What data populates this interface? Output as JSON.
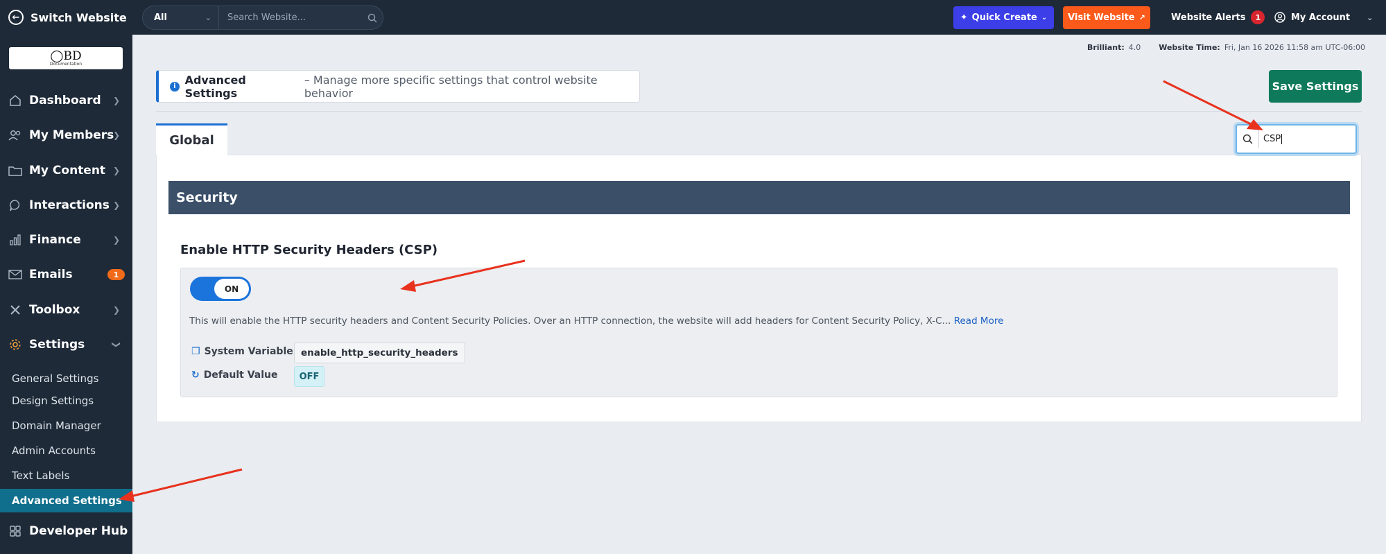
{
  "topbar": {
    "switch_label": "Switch Website",
    "search_scope": "All",
    "search_placeholder": "Search Website...",
    "quick_create": "Quick Create",
    "visit_website": "Visit Website",
    "alerts_label": "Website Alerts",
    "alerts_count": "1",
    "account_label": "My Account"
  },
  "sidebar": {
    "logo_text": "BD",
    "logo_subtext": "Documentation",
    "items": [
      {
        "label": "Dashboard",
        "icon": "home-icon"
      },
      {
        "label": "My Members",
        "icon": "members-icon"
      },
      {
        "label": "My Content",
        "icon": "folder-icon"
      },
      {
        "label": "Interactions",
        "icon": "chat-icon"
      },
      {
        "label": "Finance",
        "icon": "chart-icon"
      },
      {
        "label": "Emails",
        "icon": "mail-icon",
        "badge": "1"
      },
      {
        "label": "Toolbox",
        "icon": "tools-icon"
      },
      {
        "label": "Settings",
        "icon": "gear-icon"
      }
    ],
    "settings_sub": [
      "General Settings",
      "Design Settings",
      "Domain Manager",
      "Admin Accounts",
      "Text Labels",
      "Advanced Settings"
    ],
    "developer_hub": "Developer Hub"
  },
  "status": {
    "version_label": "Brilliant:",
    "version_value": "4.0",
    "time_label": "Website Time:",
    "time_value": "Fri, Jan 16 2026 11:58 am UTC-06:00"
  },
  "page": {
    "banner_title": "Advanced Settings",
    "banner_desc": "– Manage more specific settings that control website behavior",
    "save_button": "Save Settings",
    "tab_global": "Global",
    "settings_search_value": "CSP"
  },
  "section": {
    "title": "Security",
    "setting": {
      "title": "Enable HTTP Security Headers (CSP)",
      "toggle_state": "ON",
      "description": "This will enable the HTTP security headers and Content Security Policies. Over an HTTP connection, the website will add headers for Content Security Policy, X-C...",
      "read_more": "Read More",
      "system_variable_label": "System Variable",
      "system_variable_value": "enable_http_security_headers",
      "default_value_label": "Default Value",
      "default_value": "OFF"
    }
  },
  "colors": {
    "topbar": "#1e2a38",
    "quick_create": "#3c3ee8",
    "visit_website": "#fb5a1a",
    "save": "#0f7a5b",
    "section_header": "#3b4f69",
    "toggle_on": "#1b73dc",
    "active_sub": "#0f6f8c",
    "annotation_arrow": "#e8321e"
  }
}
